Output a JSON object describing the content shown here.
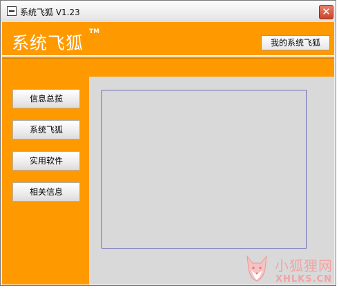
{
  "window": {
    "title": "系统飞狐 V1.23",
    "close_symbol": "✕"
  },
  "header": {
    "logo": "系统飞狐",
    "logo_mark": "TM",
    "my_button": "我的系统飞狐"
  },
  "nav": {
    "items": [
      "信息总揽",
      "系统飞狐",
      "实用软件",
      "相关信息"
    ]
  },
  "watermark": {
    "line1": "小狐狸网",
    "line2": "XHLKS.CN"
  },
  "colors": {
    "accent": "#ff9900",
    "panel": "#d9d9d9",
    "content_border": "#6b6bb8"
  },
  "icons": {
    "system_menu": "window-icon",
    "close": "close-icon",
    "watermark": "fox-icon"
  }
}
